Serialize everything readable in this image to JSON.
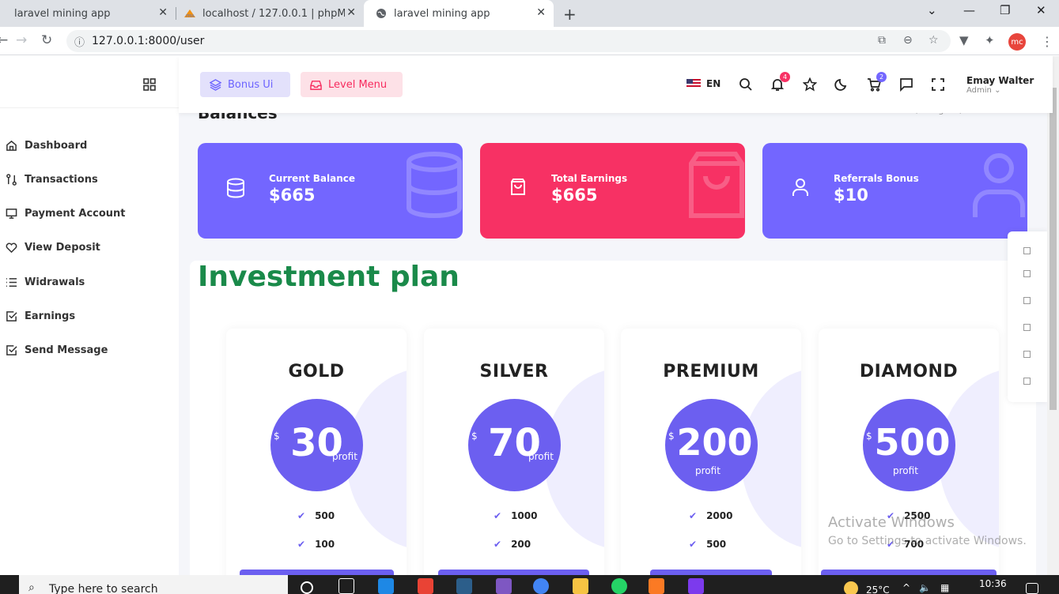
{
  "browser": {
    "tabs": [
      {
        "title": "laravel mining app",
        "active": false
      },
      {
        "title": "localhost / 127.0.0.1 | phpMyAdm",
        "active": false
      },
      {
        "title": "laravel mining app",
        "active": true
      }
    ],
    "url": "127.0.0.1:8000/user",
    "profile_initials": "mc"
  },
  "sidebar": {
    "items": [
      {
        "label": "Dashboard",
        "icon": "home-icon"
      },
      {
        "label": "Transactions",
        "icon": "transactions-icon"
      },
      {
        "label": "Payment Account",
        "icon": "monitor-icon"
      },
      {
        "label": "View Deposit",
        "icon": "heart-icon"
      },
      {
        "label": "Widrawals",
        "icon": "list-icon"
      },
      {
        "label": "Earnings",
        "icon": "check-square-icon"
      },
      {
        "label": "Send Message",
        "icon": "check-square-icon"
      }
    ]
  },
  "header": {
    "bonus_label": "Bonus Ui",
    "level_label": "Level Menu",
    "language": "EN",
    "notif_count": "4",
    "cart_count": "2",
    "user_name": "Emay Walter",
    "user_role": "Admin"
  },
  "page": {
    "title": "Balances",
    "breadcrumb": "Widgets  /  General"
  },
  "stats": [
    {
      "label": "Current Balance",
      "value": "$665",
      "color": "#7366ff"
    },
    {
      "label": "Total Earnings",
      "value": "$665",
      "color": "#f73164"
    },
    {
      "label": "Referrals Bonus",
      "value": "$10",
      "color": "#7366ff"
    }
  ],
  "investment": {
    "title": "Investment plan",
    "plans": [
      {
        "name": "GOLD",
        "currency": "$",
        "amount": "30",
        "profit": "profit",
        "features": [
          "500",
          "100"
        ]
      },
      {
        "name": "SILVER",
        "currency": "$",
        "amount": "70",
        "profit": "profit",
        "features": [
          "1000",
          "200"
        ]
      },
      {
        "name": "PREMIUM",
        "currency": "$",
        "amount": "200",
        "profit": "profit",
        "features": [
          "2000",
          "500"
        ]
      },
      {
        "name": "DIAMOND",
        "currency": "$",
        "amount": "500",
        "profit": "profit",
        "features": [
          "2500",
          "700"
        ]
      }
    ]
  },
  "watermark": {
    "line1": "Activate Windows",
    "line2": "Go to Settings to activate Windows."
  },
  "taskbar": {
    "search_placeholder": "Type here to search",
    "temperature": "25°C",
    "time": "10:36"
  }
}
